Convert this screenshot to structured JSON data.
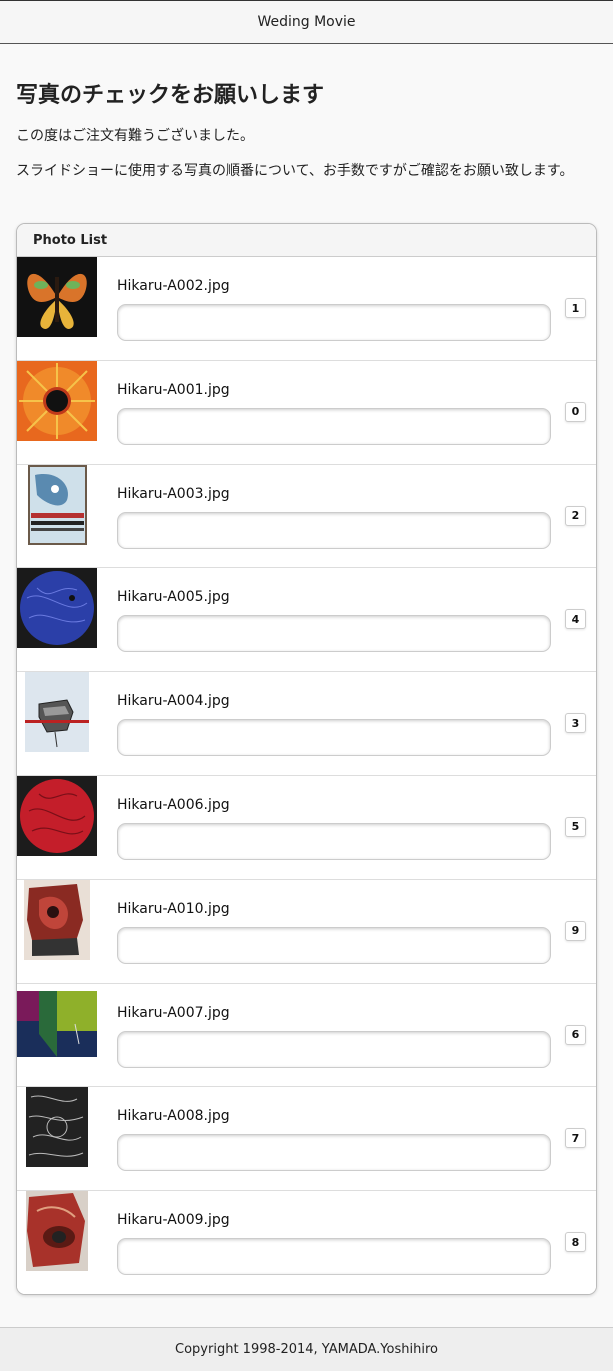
{
  "header": {
    "title": "Weding Movie"
  },
  "main": {
    "title": "写真のチェックをお願いします",
    "intro_lines": [
      "この度はご注文有難うございました。",
      "スライドショーに使用する写真の順番について、お手数ですがご確認をお願い致します。"
    ]
  },
  "photo_list": {
    "heading": "Photo List",
    "items": [
      {
        "filename": "Hikaru-A002.jpg",
        "order": "1",
        "comment": "",
        "thumb_icon": "butterfly-painting"
      },
      {
        "filename": "Hikaru-A001.jpg",
        "order": "0",
        "comment": "",
        "thumb_icon": "sunburst-painting"
      },
      {
        "filename": "Hikaru-A003.jpg",
        "order": "2",
        "comment": "",
        "thumb_icon": "abstract-face-painting"
      },
      {
        "filename": "Hikaru-A005.jpg",
        "order": "4",
        "comment": "",
        "thumb_icon": "blue-circle-painting"
      },
      {
        "filename": "Hikaru-A004.jpg",
        "order": "3",
        "comment": "",
        "thumb_icon": "sketch-face-painting"
      },
      {
        "filename": "Hikaru-A006.jpg",
        "order": "5",
        "comment": "",
        "thumb_icon": "red-circle-painting"
      },
      {
        "filename": "Hikaru-A010.jpg",
        "order": "9",
        "comment": "",
        "thumb_icon": "red-figure-painting"
      },
      {
        "filename": "Hikaru-A007.jpg",
        "order": "6",
        "comment": "",
        "thumb_icon": "green-blue-painting"
      },
      {
        "filename": "Hikaru-A008.jpg",
        "order": "7",
        "comment": "",
        "thumb_icon": "monochrome-texture-painting"
      },
      {
        "filename": "Hikaru-A009.jpg",
        "order": "8",
        "comment": "",
        "thumb_icon": "red-eye-painting"
      }
    ]
  },
  "footer": {
    "copyright": "Copyright 1998-2014, YAMADA.Yoshihiro"
  },
  "colors": {
    "header_bg": "#f6f6f6",
    "panel_head_bg": "#f5f5f5",
    "footer_bg": "#eeeeee",
    "text": "#222222"
  }
}
